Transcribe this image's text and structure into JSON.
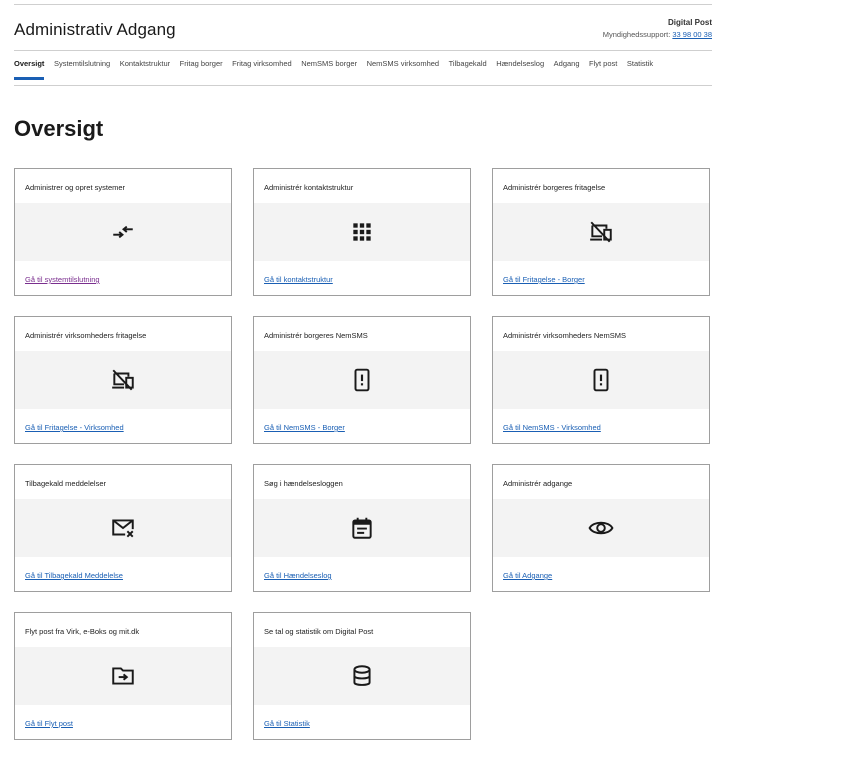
{
  "header": {
    "title": "Administrativ Adgang",
    "brand": "Digital Post",
    "support_label": "Myndighedssupport:",
    "support_phone": "33 98 00 38"
  },
  "nav": {
    "items": [
      {
        "label": "Oversigt",
        "active": true
      },
      {
        "label": "Systemtilslutning"
      },
      {
        "label": "Kontaktstruktur"
      },
      {
        "label": "Fritag borger"
      },
      {
        "label": "Fritag virksomhed"
      },
      {
        "label": "NemSMS borger"
      },
      {
        "label": "NemSMS virksomhed"
      },
      {
        "label": "Tilbagekald"
      },
      {
        "label": "Hændelseslog"
      },
      {
        "label": "Adgang"
      },
      {
        "label": "Flyt post"
      },
      {
        "label": "Statistik"
      }
    ]
  },
  "page": {
    "title": "Oversigt"
  },
  "cards": [
    {
      "title": "Administrer og opret systemer",
      "icon": "swap-arrows-icon",
      "link": "Gå til systemtilslutning",
      "visited": true
    },
    {
      "title": "Administrér kontaktstruktur",
      "icon": "grid-dots-icon",
      "link": "Gå til kontaktstruktur"
    },
    {
      "title": "Administrér borgeres fritagelse",
      "icon": "devices-off-icon",
      "link": "Gå til Fritagelse - Borger"
    },
    {
      "title": "Administrér virksomheders fritagelse",
      "icon": "devices-off-icon",
      "link": "Gå til Fritagelse - Virksomhed"
    },
    {
      "title": "Administrér borgeres NemSMS",
      "icon": "phone-alert-icon",
      "link": "Gå til NemSMS - Borger"
    },
    {
      "title": "Administrér virksomheders NemSMS",
      "icon": "phone-alert-icon",
      "link": "Gå til NemSMS - Virksomhed"
    },
    {
      "title": "Tilbagekald meddelelser",
      "icon": "mail-cancel-icon",
      "link": "Gå til Tilbagekald Meddelelse"
    },
    {
      "title": "Søg i hændelsesloggen",
      "icon": "calendar-log-icon",
      "link": "Gå til Hændelseslog"
    },
    {
      "title": "Administrér adgange",
      "icon": "eye-icon",
      "link": "Gå til Adgange"
    },
    {
      "title": "Flyt post fra Virk, e-Boks og mit.dk",
      "icon": "folder-move-icon",
      "link": "Gå til Flyt post"
    },
    {
      "title": "Se tal og statistik om Digital Post",
      "icon": "database-icon",
      "link": "Gå til Statistik"
    }
  ],
  "colors": {
    "link": "#1a5fb4",
    "visited_link": "#7a2e8e",
    "active_underline": "#1a5fb4",
    "icon_area": "#f3f3f3"
  }
}
